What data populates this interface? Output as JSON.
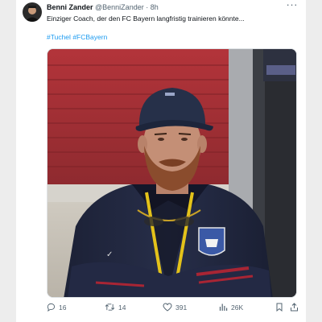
{
  "tweet": {
    "author_name": "Benni Zander",
    "author_handle": "@BenniZander",
    "separator": "·",
    "time": "8h",
    "more": "···",
    "text": "Einziger Coach, der den FC Bayern langfristig trainieren könnte...",
    "hashtags": [
      "#Tuchel",
      "#FCBayern"
    ]
  },
  "actions": {
    "replies": "16",
    "retweets": "14",
    "likes": "391",
    "views": "26K"
  },
  "colors": {
    "accent": "#1d9bf0",
    "text": "#0f1419",
    "muted": "#536471"
  },
  "icons": [
    "avatar",
    "more-icon",
    "reply-icon",
    "retweet-icon",
    "like-icon",
    "views-icon",
    "bookmark-icon",
    "share-icon"
  ]
}
